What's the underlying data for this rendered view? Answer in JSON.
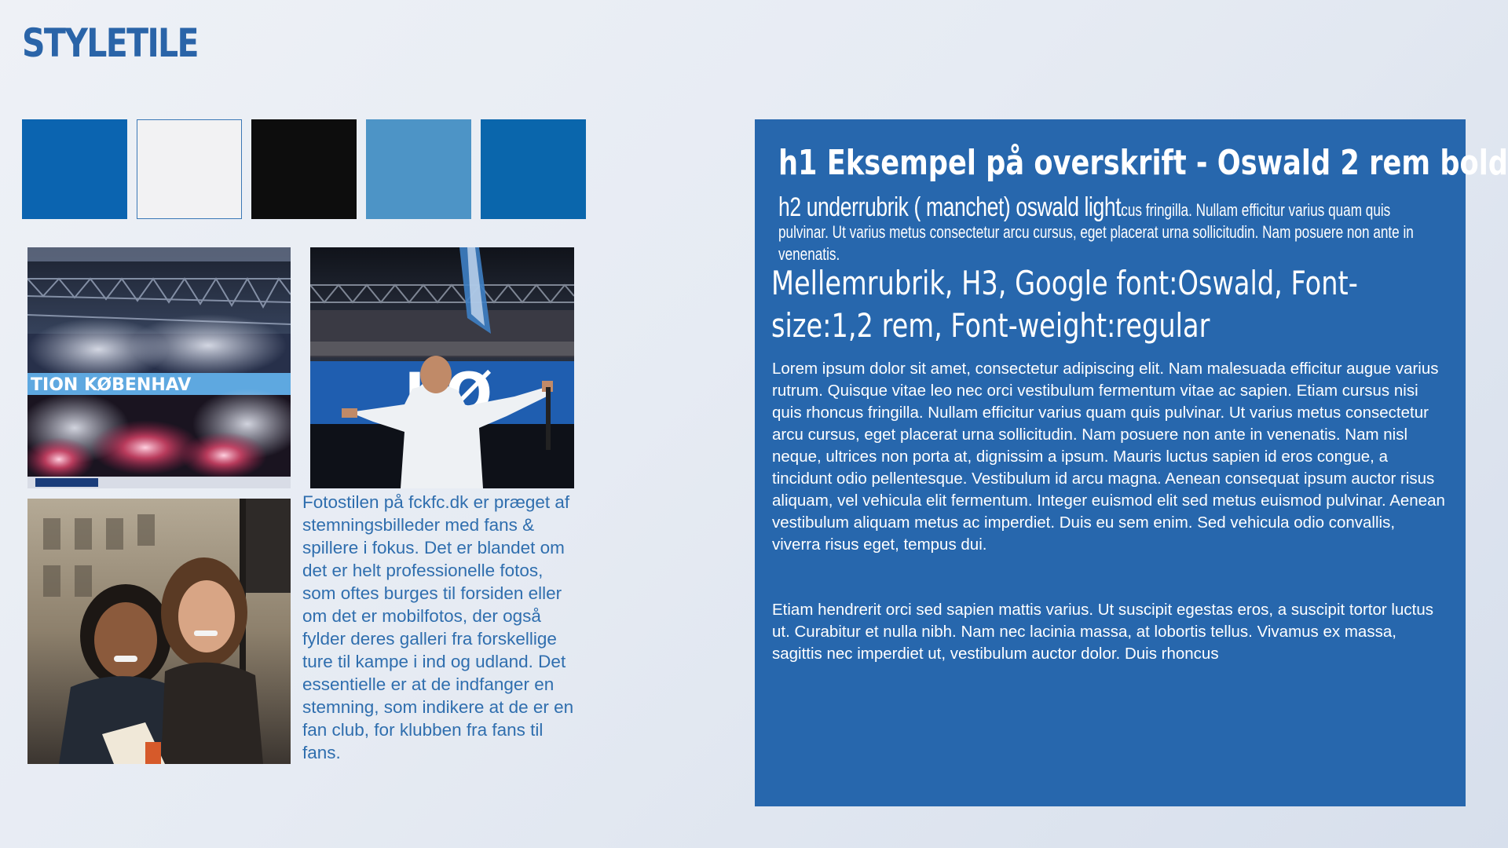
{
  "page": {
    "title": "STYLETILE"
  },
  "palette": {
    "swatches": [
      {
        "name": "swatch-primary-blue",
        "color": "#0b64b0"
      },
      {
        "name": "swatch-off-white",
        "color": "#f2f2f3"
      },
      {
        "name": "swatch-black",
        "color": "#0d0d0d"
      },
      {
        "name": "swatch-light-blue",
        "color": "#4d94c6"
      },
      {
        "name": "swatch-deep-blue",
        "color": "#0a66ac"
      }
    ]
  },
  "photos": {
    "description": "Fotostilen på fckfc.dk er præget af stemningsbilleder med fans & spillere i fokus. Det er blandet om det er helt professionelle fotos, som oftes burges til forsiden  eller om det er mobilfotos, der også fylder deres galleri fra forskellige ture til kampe i ind og udland.   Det essentielle er at de indfanger en stemning, som indikere at de er en fan club, for klubben fra fans til fans.",
    "photo1_banner": "TION  KØBENHAV",
    "photo2_banner": "KØ"
  },
  "typography": {
    "h1": "h1 Eksempel på overskrift -  Oswald 2 rem bold",
    "h2_lead": "h2 underrubrik ( manchet) oswald light",
    "h2_rest": "cus fringilla. Nullam efficitur varius quam quis pulvinar. Ut varius metus consectetur arcu cursus, eget placerat urna sollicitudin. Nam posuere non ante in venenatis.",
    "h3": "Mellemrubrik, H3, Google font:Oswald, Font-size:1,2 rem, Font-weight:regular",
    "body1": "Lorem ipsum dolor sit amet, consectetur adipiscing elit. Nam malesuada efficitur augue varius rutrum. Quisque vitae leo nec orci vestibulum fermentum vitae ac sapien. Etiam cursus nisi quis rhoncus fringilla. Nullam efficitur varius quam quis pulvinar. Ut varius metus consectetur arcu cursus, eget placerat urna sollicitudin. Nam posuere non ante in venenatis. Nam nisl neque, ultrices non porta at, dignissim a ipsum. Mauris luctus sapien id eros congue, a tincidunt odio pellentesque. Vestibulum id arcu magna. Aenean consequat ipsum auctor risus aliquam, vel vehicula elit fermentum. Integer euismod elit sed metus euismod pulvinar. Aenean vestibulum aliquam metus ac imperdiet. Duis eu sem enim. Sed vehicula odio convallis, viverra risus eget, tempus dui.",
    "body2": "Etiam hendrerit orci sed sapien mattis varius. Ut suscipit egestas eros, a suscipit tortor luctus ut. Curabitur et nulla nibh. Nam nec lacinia massa, at lobortis tellus. Vivamus ex massa, sagittis nec imperdiet ut, vestibulum auctor dolor. Duis rhoncus"
  },
  "colors": {
    "page_accent": "#2a64a8",
    "panel_background": "#2767ad",
    "photo_text": "#2f6eae"
  }
}
